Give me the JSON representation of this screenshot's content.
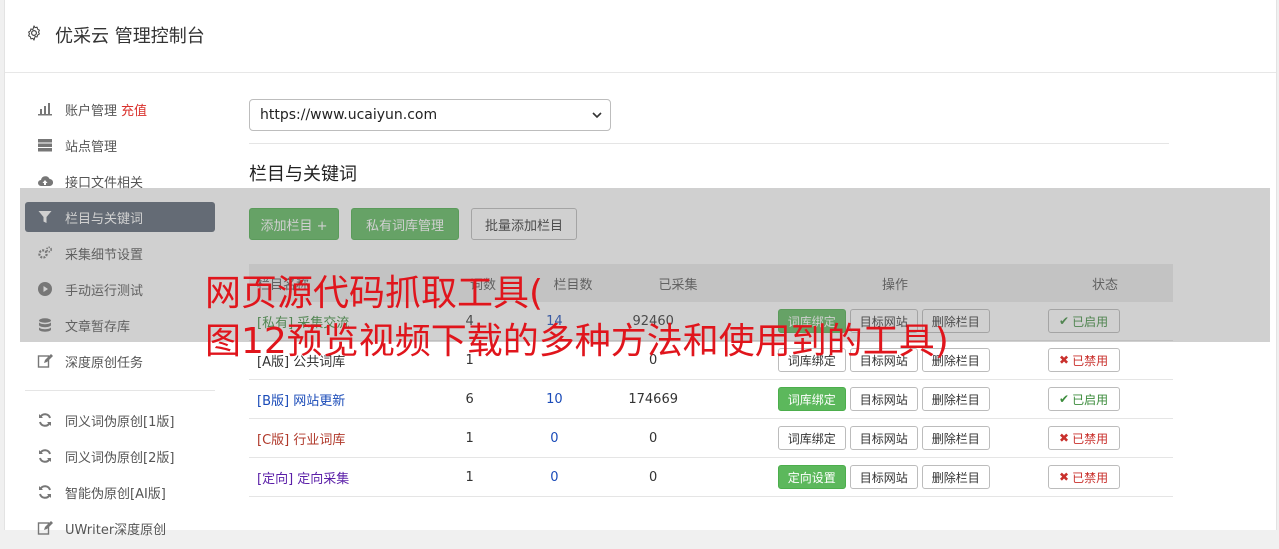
{
  "header": {
    "title": "优采云 管理控制台",
    "icon": "gear-icon"
  },
  "sidebar": {
    "items": [
      {
        "label": "账户管理",
        "badge": "充值",
        "icon": "bar-chart-icon",
        "active": false
      },
      {
        "label": "站点管理",
        "icon": "server-icon",
        "active": false
      },
      {
        "label": "接口文件相关",
        "icon": "cloud-upload-icon",
        "active": false
      },
      {
        "label": "栏目与关键词",
        "icon": "filter-icon",
        "active": true
      },
      {
        "label": "采集细节设置",
        "icon": "cogs-icon",
        "active": false
      },
      {
        "label": "手动运行测试",
        "icon": "play-circle-icon",
        "active": false
      },
      {
        "label": "文章暂存库",
        "icon": "database-icon",
        "active": false
      },
      {
        "label": "深度原创任务",
        "icon": "edit-icon",
        "active": false
      }
    ],
    "items2": [
      {
        "label": "同义词伪原创[1版]",
        "icon": "refresh-icon"
      },
      {
        "label": "同义词伪原创[2版]",
        "icon": "refresh-icon"
      },
      {
        "label": "智能伪原创[AI版]",
        "icon": "refresh-icon"
      },
      {
        "label": "UWriter深度原创",
        "icon": "edit-icon"
      }
    ]
  },
  "site_select": {
    "value": "https://www.ucaiyun.com"
  },
  "section": {
    "title": "栏目与关键词"
  },
  "toolbar": {
    "add_column": "添加栏目 +",
    "private_lib": "私有词库管理",
    "batch_add": "批量添加栏目"
  },
  "table": {
    "headers": {
      "name": "栏目名称",
      "keywords": "词数",
      "cat": "栏目数",
      "collected": "已采集",
      "ops": "操作",
      "status": "状态"
    },
    "rows": [
      {
        "tag": "[私有]",
        "name": "采集交流",
        "tag_color": "#3c8c3c",
        "kw": "4",
        "cat": "14",
        "collected": "92460",
        "op1": "词库绑定",
        "op1_green": true,
        "op2": "目标网站",
        "op3": "删除栏目",
        "status": "已启用",
        "on": true
      },
      {
        "tag": "[A版]",
        "name": "公共词库",
        "tag_color": "#333333",
        "kw": "1",
        "cat": "",
        "collected": "0",
        "op1": "词库绑定",
        "op1_green": false,
        "op2": "目标网站",
        "op3": "删除栏目",
        "status": "已禁用",
        "on": false
      },
      {
        "tag": "[B版]",
        "name": "网站更新",
        "tag_color": "#1a4bb8",
        "kw": "6",
        "cat": "10",
        "collected": "174669",
        "op1": "词库绑定",
        "op1_green": true,
        "op2": "目标网站",
        "op3": "删除栏目",
        "status": "已启用",
        "on": true
      },
      {
        "tag": "[C版]",
        "name": "行业词库",
        "tag_color": "#b0392b",
        "kw": "1",
        "cat": "0",
        "collected": "0",
        "op1": "词库绑定",
        "op1_green": false,
        "op2": "目标网站",
        "op3": "删除栏目",
        "status": "已禁用",
        "on": false
      },
      {
        "tag": "[定向]",
        "name": "定向采集",
        "tag_color": "#5b1fa8",
        "kw": "1",
        "cat": "0",
        "collected": "0",
        "op1": "定向设置",
        "op1_green": true,
        "op2": "目标网站",
        "op3": "删除栏目",
        "status": "已禁用",
        "on": false
      }
    ]
  },
  "overlay_text": {
    "line1": "网页源代码抓取工具(",
    "line2": "图12预览视频下载的多种方法和使用到的工具)"
  }
}
